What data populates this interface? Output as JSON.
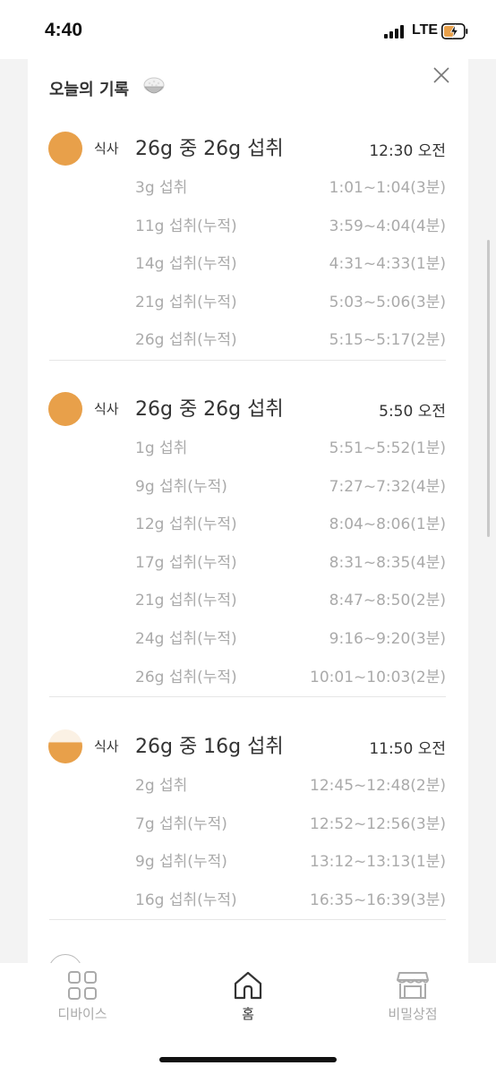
{
  "status_bar": {
    "time": "4:40",
    "network": "LTE"
  },
  "card": {
    "title": "오늘의 기록",
    "meals": [
      {
        "label": "식사",
        "summary": "26g 중 26g 섭취",
        "time": "12:30 오전",
        "fill": 1.0,
        "entries": [
          {
            "amount": "3g 섭취",
            "range": "1:01~1:04(3분)"
          },
          {
            "amount": "11g 섭취(누적)",
            "range": "3:59~4:04(4분)"
          },
          {
            "amount": "14g 섭취(누적)",
            "range": "4:31~4:33(1분)"
          },
          {
            "amount": "21g 섭취(누적)",
            "range": "5:03~5:06(3분)"
          },
          {
            "amount": "26g 섭취(누적)",
            "range": "5:15~5:17(2분)"
          }
        ]
      },
      {
        "label": "식사",
        "summary": "26g 중 26g 섭취",
        "time": "5:50 오전",
        "fill": 1.0,
        "entries": [
          {
            "amount": "1g 섭취",
            "range": "5:51~5:52(1분)"
          },
          {
            "amount": "9g 섭취(누적)",
            "range": "7:27~7:32(4분)"
          },
          {
            "amount": "12g 섭취(누적)",
            "range": "8:04~8:06(1분)"
          },
          {
            "amount": "17g 섭취(누적)",
            "range": "8:31~8:35(4분)"
          },
          {
            "amount": "21g 섭취(누적)",
            "range": "8:47~8:50(2분)"
          },
          {
            "amount": "24g 섭취(누적)",
            "range": "9:16~9:20(3분)"
          },
          {
            "amount": "26g 섭취(누적)",
            "range": "10:01~10:03(2분)"
          }
        ]
      },
      {
        "label": "식사",
        "summary": "26g 중 16g 섭취",
        "time": "11:50 오전",
        "fill": 0.62,
        "entries": [
          {
            "amount": "2g 섭취",
            "range": "12:45~12:48(2분)"
          },
          {
            "amount": "7g 섭취(누적)",
            "range": "12:52~12:56(3분)"
          },
          {
            "amount": "9g 섭취(누적)",
            "range": "13:12~13:13(1분)"
          },
          {
            "amount": "16g 섭취(누적)",
            "range": "16:35~16:39(3분)"
          }
        ]
      }
    ]
  },
  "bottom_nav": [
    {
      "label": "디바이스",
      "icon": "grid-icon",
      "active": false
    },
    {
      "label": "홈",
      "icon": "home-icon",
      "active": true
    },
    {
      "label": "비밀상점",
      "icon": "store-icon",
      "active": false
    }
  ],
  "colors": {
    "accent": "#E8A04A",
    "muted_text": "#AAAAAA",
    "divider": "#E6E6E6",
    "icon_gray": "#AAAAAA"
  }
}
